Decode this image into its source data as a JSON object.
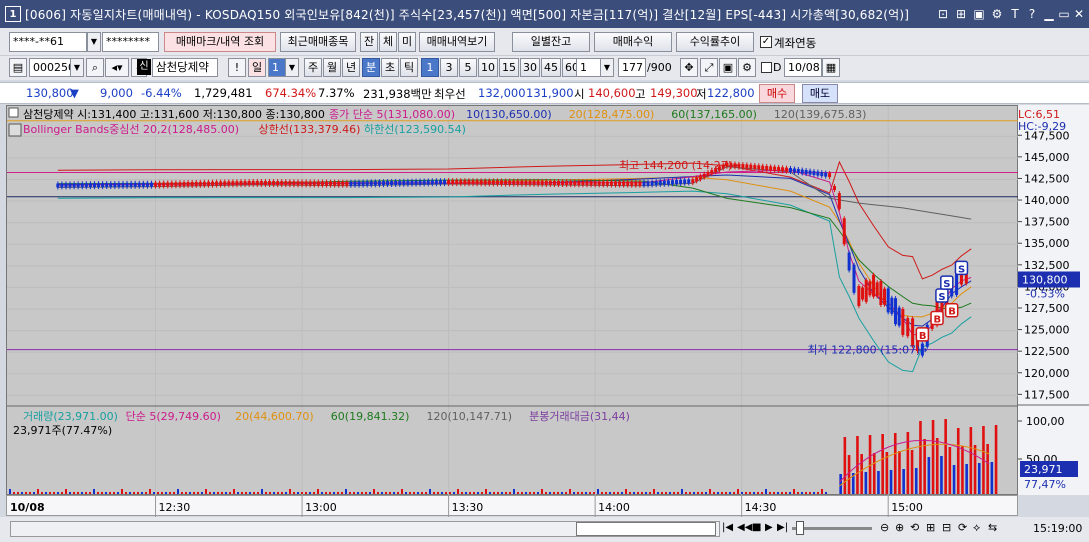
{
  "window": {
    "number": "1",
    "title": "[0606] 자동일지차트(매매내역) - KOSDAQ150 외국인보유[842(천)] 주식수[23,457(천)] 액면[500] 자본금[117(억)] 결산[12월] EPS[-443] 시가총액[30,682(억)]"
  },
  "toolbar1": {
    "account": "****-**61",
    "password": "********",
    "mark_button": "매매마크/내역 조회",
    "recent_button": "최근매매종목",
    "mode1": "잔",
    "mode2": "체",
    "mode3": "미",
    "history_button": "매매내역보기",
    "daily_balance_button": "일별잔고",
    "trade_profit_button": "매매수익",
    "profit_trend_button": "수익률추이",
    "account_link_label": "계좌연동"
  },
  "toolbar2": {
    "code": "000250",
    "stock_badge": "신",
    "stock_name": "삼천당제약",
    "day_label": "일",
    "day_count": "1",
    "week": "주",
    "month": "월",
    "year": "년",
    "minute": "분",
    "second": "초",
    "tick": "틱",
    "intervals": [
      "1",
      "3",
      "5",
      "10",
      "15",
      "30",
      "45",
      "60"
    ],
    "interval_active": "1",
    "unit_value": "1",
    "count_value": "177",
    "count_max": "/900",
    "date_value": "10/08"
  },
  "quote": {
    "price": "130,800",
    "change": "9,000",
    "change_pct": "-6.44%",
    "volume": "1,729,481",
    "volume_ratio": "674.34%",
    "turnover": "7.37%",
    "amount": "231,938백만",
    "best_ask_label": "최우선",
    "ask": "132,000",
    "bid": "131,900",
    "open_label": "시",
    "open": "140,600",
    "high_label": "고",
    "high": "149,300",
    "low_label": "저",
    "low": "122,800",
    "buy_button": "매수",
    "sell_button": "매도"
  },
  "chart_data": [
    {
      "type": "line",
      "title": "삼천당제약 시:131,400 고:131,600 저:130,800 종:130,800",
      "legend": [
        {
          "text": "종가 단순 5(131,080.00)",
          "color": "#cc1a8c"
        },
        {
          "text": "10(130,650.00)",
          "color": "#1b2fb0"
        },
        {
          "text": "20(128,475.00)",
          "color": "#e09010"
        },
        {
          "text": "60(137,165.00)",
          "color": "#1e7a1e"
        },
        {
          "text": "120(139,675.83)",
          "color": "#606060"
        },
        {
          "text": "Bollinger Bands중심선 20,2(128,485.00)",
          "color": "#cc1a8c"
        },
        {
          "text": "상한선(133,379.46)",
          "color": "#d01818"
        },
        {
          "text": "하한선(123,590.54)",
          "color": "#18a0a0"
        }
      ],
      "x_ticks": [
        "12:30",
        "13:00",
        "13:30",
        "14:00",
        "14:30",
        "15:00"
      ],
      "date_label": "10/08",
      "y_ticks": [
        "147,500",
        "145,000",
        "142,500",
        "140,000",
        "137,500",
        "135,000",
        "132,500",
        "130,000",
        "127,500",
        "125,000",
        "122,500",
        "120,000",
        "117,500"
      ],
      "ylim": [
        116500,
        149500
      ],
      "current_price": "130,800",
      "current_change": "-0.53%",
      "lc_label": "LC:6,51",
      "hc_label": "HC:-9,29",
      "annotations": {
        "high": "최고 144,200 (14:27)",
        "low": "최저 122,800 (15:07)"
      },
      "trade_marks": [
        "S",
        "S",
        "S",
        "B",
        "B",
        "B"
      ],
      "price_series": [
        [
          "12:10",
          141800
        ],
        [
          "12:30",
          141900
        ],
        [
          "12:50",
          142100
        ],
        [
          "13:10",
          142000
        ],
        [
          "13:30",
          142200
        ],
        [
          "13:50",
          142100
        ],
        [
          "14:10",
          142000
        ],
        [
          "14:20",
          142300
        ],
        [
          "14:27",
          144200
        ],
        [
          "14:40",
          143600
        ],
        [
          "14:48",
          143000
        ],
        [
          "14:50",
          140000
        ],
        [
          "14:52",
          133000
        ],
        [
          "14:54",
          129000
        ],
        [
          "14:57",
          130200
        ],
        [
          "15:00",
          128500
        ],
        [
          "15:03",
          126000
        ],
        [
          "15:05",
          124800
        ],
        [
          "15:07",
          122800
        ],
        [
          "15:09",
          126000
        ],
        [
          "15:11",
          128000
        ],
        [
          "15:13",
          130000
        ],
        [
          "15:15",
          131500
        ],
        [
          "15:17",
          130800
        ]
      ]
    },
    {
      "type": "bar",
      "title": "거래량(23,971.00) 단순 5(29,749.60) 20(44,600.70) 60(19,841.32) 120(10,147.71) 분봉거래대금(31,44)",
      "legend": [
        {
          "text": "거래량(23,971.00)",
          "color": "#18a0a0"
        },
        {
          "text": "단순 5(29,749.60)",
          "color": "#cc1a8c"
        },
        {
          "text": "20(44,600.70)",
          "color": "#e09010"
        },
        {
          "text": "60(19,841.32)",
          "color": "#1e7a1e"
        },
        {
          "text": "120(10,147.71)",
          "color": "#606060"
        },
        {
          "text": "분봉거래대금(31,44)",
          "color": "#7c3ca0"
        }
      ],
      "sub_label": "23,971주(77.47%)",
      "y_ticks": [
        "100,00",
        "50,00"
      ],
      "current_volume": "23,971",
      "current_pct": "77,47%"
    }
  ],
  "bottom": {
    "time": "15:19:00"
  }
}
